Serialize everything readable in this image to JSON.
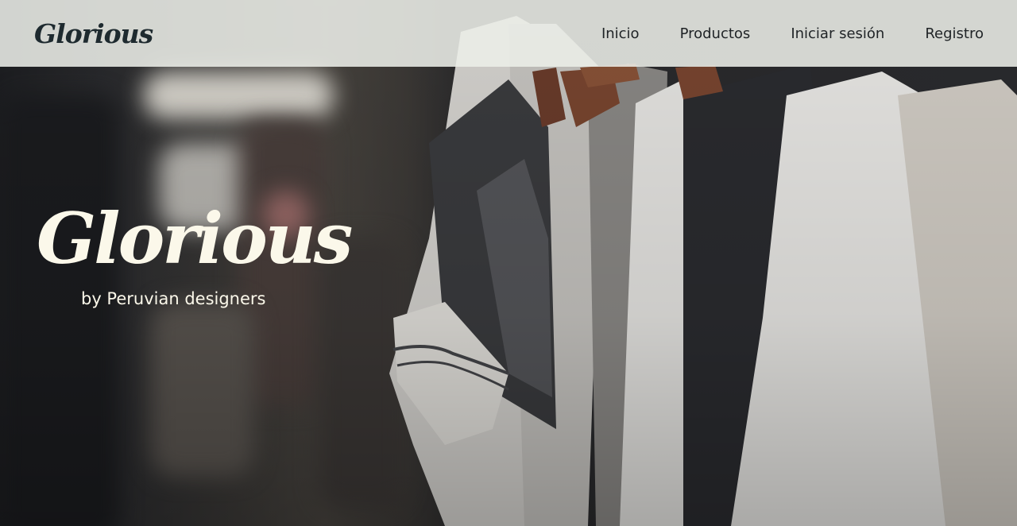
{
  "navbar": {
    "brand": "Glorious",
    "links": [
      {
        "label": "Inicio"
      },
      {
        "label": "Productos"
      },
      {
        "label": "Iniciar sesión"
      },
      {
        "label": "Registro"
      }
    ]
  },
  "hero": {
    "title": "Glorious",
    "subtitle": "by Peruvian designers"
  },
  "colors": {
    "navbar_bg": "#eceee8",
    "nav_text": "#1f2326",
    "hero_text": "#fbf8ea"
  }
}
